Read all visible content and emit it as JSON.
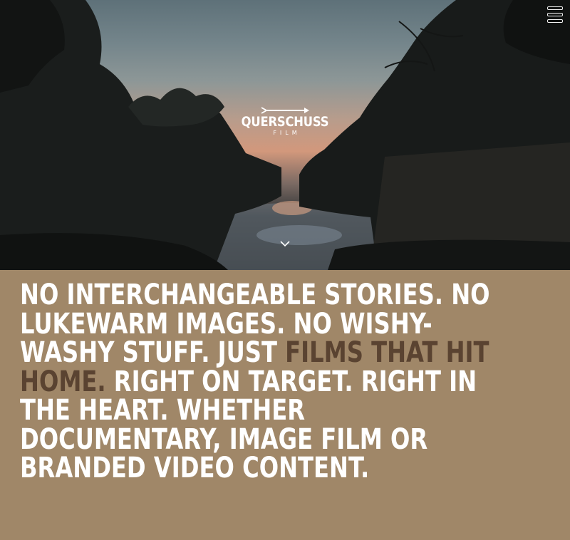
{
  "header": {
    "logo": {
      "name": "QUERSCHUSS",
      "sub": "FILM"
    },
    "menu_icon": "hamburger-menu-icon",
    "scroll_icon": "chevron-down-icon"
  },
  "statement": {
    "part1": "NO INTERCHANGEABLE STORIES. NO LUKEWARM IMAGES. NO WISHY-WASHY STUFF. JUST ",
    "highlight": "FILMS THAT HIT HOME.",
    "part2": " RIGHT ON TARGET. RIGHT IN THE HEART. WHETHER DOCUMENTARY, IMAGE FILM OR BRANDED VIDEO CONTENT."
  },
  "colors": {
    "section_background": "#a08768",
    "accent_text": "#5a4331",
    "text": "#ffffff"
  }
}
